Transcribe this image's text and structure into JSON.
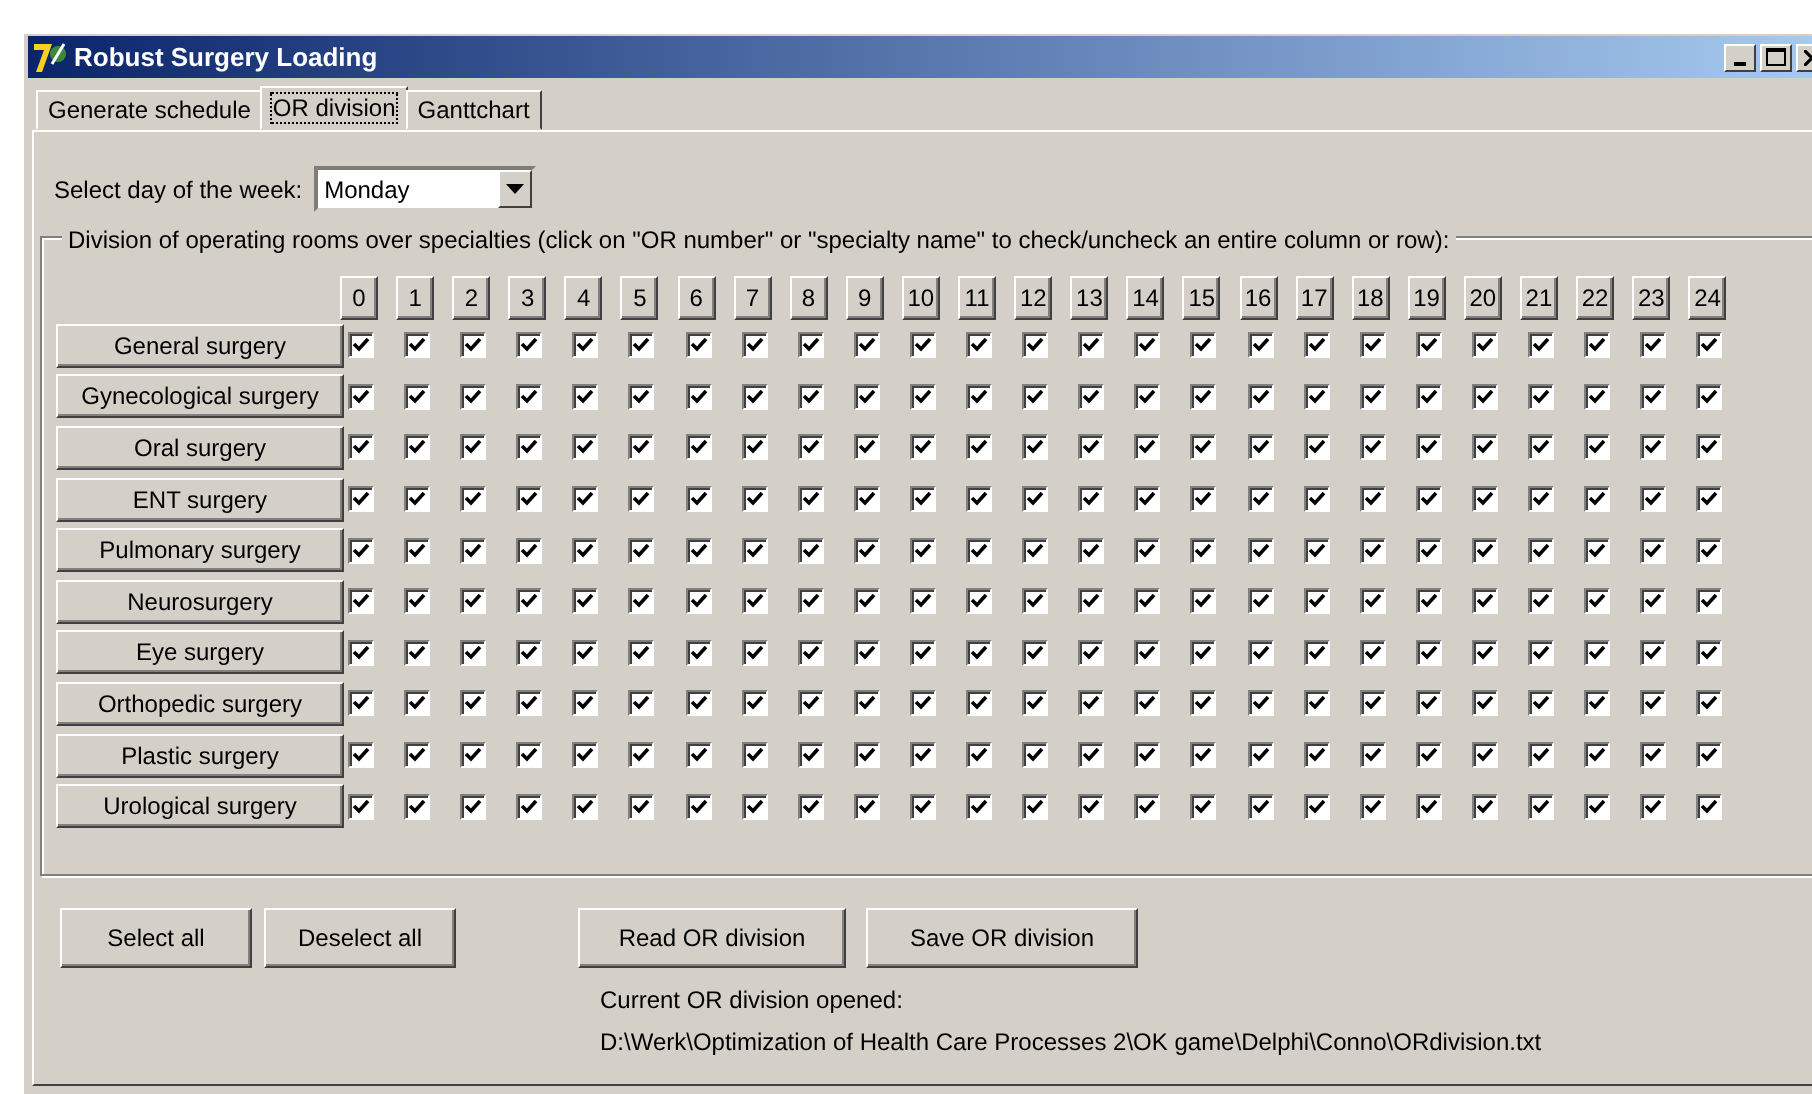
{
  "window": {
    "title": "Robust Surgery Loading"
  },
  "tabs": [
    {
      "label": "Generate schedule",
      "selected": false
    },
    {
      "label": "OR division",
      "selected": true
    },
    {
      "label": "Ganttchart",
      "selected": false
    }
  ],
  "day_select": {
    "label": "Select day of the week:",
    "value": "Monday"
  },
  "group": {
    "caption": "Division of operating rooms over specialties (click on \"OR number\" or \"specialty name\" to check/uncheck an entire column or row):",
    "columns": [
      "0",
      "1",
      "2",
      "3",
      "4",
      "5",
      "6",
      "7",
      "8",
      "9",
      "10",
      "11",
      "12",
      "13",
      "14",
      "15",
      "16",
      "17",
      "18",
      "19",
      "20",
      "21",
      "22",
      "23",
      "24"
    ],
    "rows": [
      {
        "name": "General surgery",
        "checked": [
          true,
          true,
          true,
          true,
          true,
          true,
          true,
          true,
          true,
          true,
          true,
          true,
          true,
          true,
          true,
          true,
          true,
          true,
          true,
          true,
          true,
          true,
          true,
          true,
          true
        ]
      },
      {
        "name": "Gynecological surgery",
        "checked": [
          true,
          true,
          true,
          true,
          true,
          true,
          true,
          true,
          true,
          true,
          true,
          true,
          true,
          true,
          true,
          true,
          true,
          true,
          true,
          true,
          true,
          true,
          true,
          true,
          true
        ]
      },
      {
        "name": "Oral surgery",
        "checked": [
          true,
          true,
          true,
          true,
          true,
          true,
          true,
          true,
          true,
          true,
          true,
          true,
          true,
          true,
          true,
          true,
          true,
          true,
          true,
          true,
          true,
          true,
          true,
          true,
          true
        ]
      },
      {
        "name": "ENT surgery",
        "checked": [
          true,
          true,
          true,
          true,
          true,
          true,
          true,
          true,
          true,
          true,
          true,
          true,
          true,
          true,
          true,
          true,
          true,
          true,
          true,
          true,
          true,
          true,
          true,
          true,
          true
        ]
      },
      {
        "name": "Pulmonary surgery",
        "checked": [
          true,
          true,
          true,
          true,
          true,
          true,
          true,
          true,
          true,
          true,
          true,
          true,
          true,
          true,
          true,
          true,
          true,
          true,
          true,
          true,
          true,
          true,
          true,
          true,
          true
        ]
      },
      {
        "name": "Neurosurgery",
        "checked": [
          true,
          true,
          true,
          true,
          true,
          true,
          true,
          true,
          true,
          true,
          true,
          true,
          true,
          true,
          true,
          true,
          true,
          true,
          true,
          true,
          true,
          true,
          true,
          true,
          true
        ]
      },
      {
        "name": "Eye surgery",
        "checked": [
          true,
          true,
          true,
          true,
          true,
          true,
          true,
          true,
          true,
          true,
          true,
          true,
          true,
          true,
          true,
          true,
          true,
          true,
          true,
          true,
          true,
          true,
          true,
          true,
          true
        ]
      },
      {
        "name": "Orthopedic surgery",
        "checked": [
          true,
          true,
          true,
          true,
          true,
          true,
          true,
          true,
          true,
          true,
          true,
          true,
          true,
          true,
          true,
          true,
          true,
          true,
          true,
          true,
          true,
          true,
          true,
          true,
          true
        ]
      },
      {
        "name": "Plastic surgery",
        "checked": [
          true,
          true,
          true,
          true,
          true,
          true,
          true,
          true,
          true,
          true,
          true,
          true,
          true,
          true,
          true,
          true,
          true,
          true,
          true,
          true,
          true,
          true,
          true,
          true,
          true
        ]
      },
      {
        "name": "Urological surgery",
        "checked": [
          true,
          true,
          true,
          true,
          true,
          true,
          true,
          true,
          true,
          true,
          true,
          true,
          true,
          true,
          true,
          true,
          true,
          true,
          true,
          true,
          true,
          true,
          true,
          true,
          true
        ]
      }
    ]
  },
  "buttons": [
    "Select all",
    "Deselect all",
    "Read OR division",
    "Save OR division"
  ],
  "current_file": {
    "label": "Current OR division opened:",
    "path": "D:\\Werk\\Optimization of Health Care Processes 2\\OK game\\Delphi\\Conno\\ORdivision.txt"
  }
}
